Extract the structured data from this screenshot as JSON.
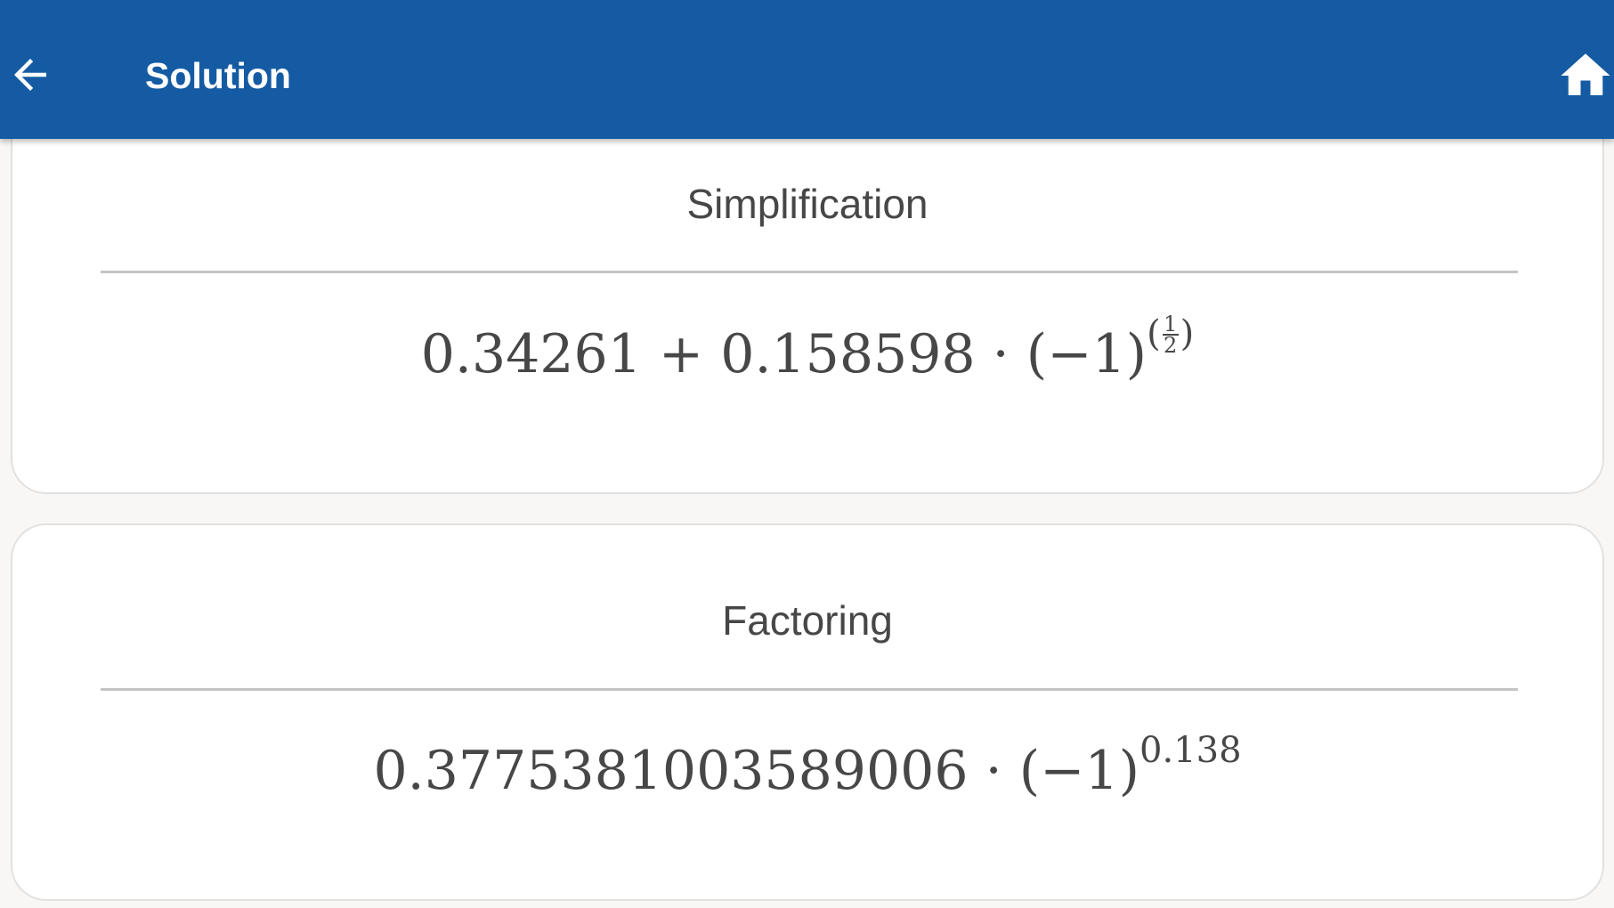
{
  "appbar": {
    "title": "Solution",
    "back_icon": "arrow-left-icon",
    "home_icon": "home-icon",
    "background_color": "#155ba3"
  },
  "simplification": {
    "heading": "Simplification",
    "expression": {
      "constant": "0.34261",
      "plus": "+",
      "coefficient": "0.158598",
      "dot": "·",
      "base": "(−1)",
      "exponent_open": "(",
      "exponent_numerator": "1",
      "exponent_denominator": "2",
      "exponent_close": ")"
    }
  },
  "factoring": {
    "heading": "Factoring",
    "expression": {
      "coefficient": "0.3775381003589006",
      "dot": "·",
      "base": "(−1)",
      "exponent": "0.138"
    }
  }
}
